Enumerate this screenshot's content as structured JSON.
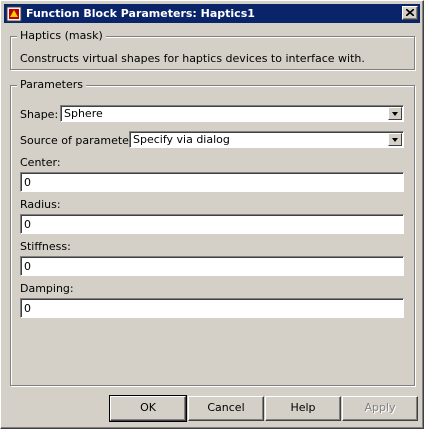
{
  "window": {
    "title": "Function Block Parameters: Haptics1"
  },
  "mask_group": {
    "legend": "Haptics (mask)",
    "description": "Constructs virtual shapes for haptics devices to interface with."
  },
  "parameters_group": {
    "legend": "Parameters",
    "shape": {
      "label": "Shape:",
      "value": "Sphere"
    },
    "source": {
      "label": "Source of parameters:",
      "value": "Specify via dialog"
    },
    "fields": [
      {
        "label": "Center:",
        "value": "0"
      },
      {
        "label": "Radius:",
        "value": "0"
      },
      {
        "label": "Stiffness:",
        "value": "0"
      },
      {
        "label": "Damping:",
        "value": "0"
      }
    ]
  },
  "buttons": {
    "ok": "OK",
    "cancel": "Cancel",
    "help": "Help",
    "apply": "Apply"
  },
  "colors": {
    "title_bar": "#0a246a",
    "face": "#d4d0c8"
  },
  "icons": [
    "simulink-block-icon",
    "close-icon",
    "dropdown-arrow-icon"
  ]
}
